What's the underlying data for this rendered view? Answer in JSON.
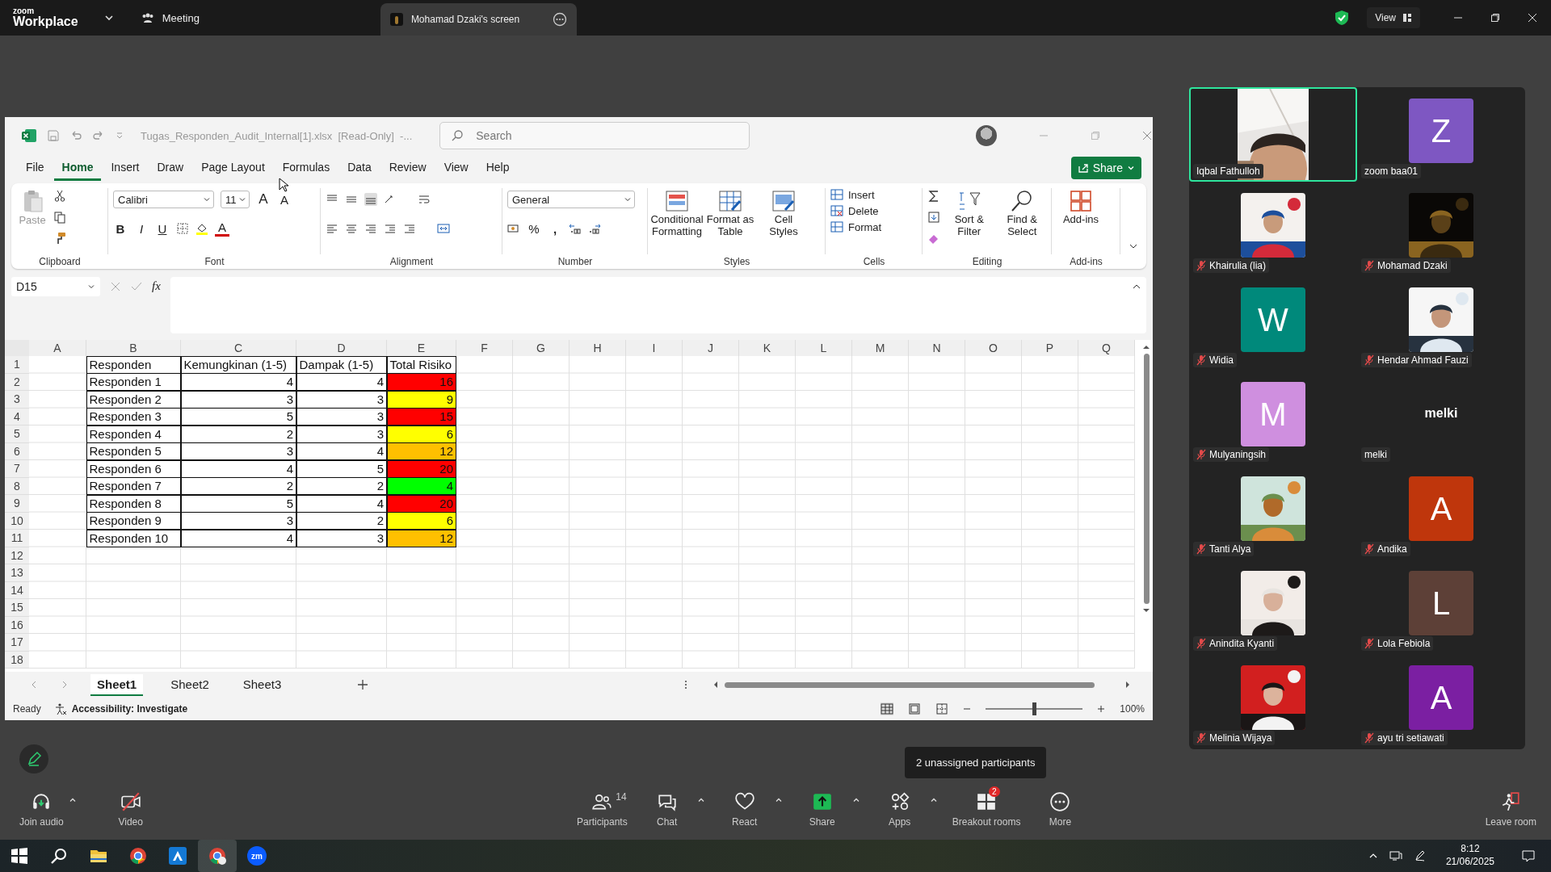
{
  "zoom_bar": {
    "logo_small": "zoom",
    "logo_big": "Workplace",
    "meeting": "Meeting",
    "share_tab": "Mohamad Dzaki's screen",
    "view": "View"
  },
  "excel": {
    "title": "Tugas_Responden_Audit_Internal[1].xlsx  [Read-Only]  -...",
    "search_placeholder": "Search",
    "menu_tabs": [
      {
        "label": "File",
        "selected": false
      },
      {
        "label": "Home",
        "selected": true
      },
      {
        "label": "Insert",
        "selected": false
      },
      {
        "label": "Draw",
        "selected": false
      },
      {
        "label": "Page Layout",
        "selected": false
      },
      {
        "label": "Formulas",
        "selected": false
      },
      {
        "label": "Data",
        "selected": false
      },
      {
        "label": "Review",
        "selected": false
      },
      {
        "label": "View",
        "selected": false
      },
      {
        "label": "Help",
        "selected": false
      }
    ],
    "share_button": "Share",
    "ribbon": {
      "paste": "Paste",
      "font_name": "Calibri",
      "font_size": "11",
      "grow_font": "A",
      "shrink_font": "A",
      "bold": "B",
      "italic": "I",
      "underline": "U",
      "font_color": "A",
      "number_format": "General",
      "percent": "%",
      "comma": ",",
      "styles": [
        "Conditional Formatting",
        "Format as Table",
        "Cell Styles"
      ],
      "cells": [
        "Insert",
        "Delete",
        "Format"
      ],
      "editing": [
        "Sort & Filter",
        "Find & Select"
      ],
      "addins": "Add-ins",
      "group_labels": [
        "Clipboard",
        "Font",
        "Alignment",
        "Number",
        "Styles",
        "Cells",
        "Editing",
        "Add-ins"
      ]
    },
    "formula_bar": {
      "name_box": "D15",
      "fx": "fx"
    },
    "columns": [
      "A",
      "B",
      "C",
      "D",
      "E",
      "F",
      "G",
      "H",
      "I",
      "J",
      "K",
      "L",
      "M",
      "N",
      "O",
      "P",
      "Q"
    ],
    "row_numbers": [
      "1",
      "2",
      "3",
      "4",
      "5",
      "6",
      "7",
      "8",
      "9",
      "10",
      "11",
      "12",
      "13",
      "14",
      "15",
      "16",
      "17",
      "18"
    ],
    "sheet": {
      "header": [
        "Responden",
        "Kemungkinan (1-5)",
        "Dampak (1-5)",
        "Total Risiko"
      ],
      "rows": [
        {
          "name": "Responden 1",
          "likelihood": "4",
          "impact": "4",
          "total": "16",
          "color": "#ff0000"
        },
        {
          "name": "Responden 2",
          "likelihood": "3",
          "impact": "3",
          "total": "9",
          "color": "#ffff00"
        },
        {
          "name": "Responden 3",
          "likelihood": "5",
          "impact": "3",
          "total": "15",
          "color": "#ff0000"
        },
        {
          "name": "Responden 4",
          "likelihood": "2",
          "impact": "3",
          "total": "6",
          "color": "#ffff00"
        },
        {
          "name": "Responden 5",
          "likelihood": "3",
          "impact": "4",
          "total": "12",
          "color": "#ffc000"
        },
        {
          "name": "Responden 6",
          "likelihood": "4",
          "impact": "5",
          "total": "20",
          "color": "#ff0000"
        },
        {
          "name": "Responden 7",
          "likelihood": "2",
          "impact": "2",
          "total": "4",
          "color": "#00ff00"
        },
        {
          "name": "Responden 8",
          "likelihood": "5",
          "impact": "4",
          "total": "20",
          "color": "#ff0000"
        },
        {
          "name": "Responden 9",
          "likelihood": "3",
          "impact": "2",
          "total": "6",
          "color": "#ffff00"
        },
        {
          "name": "Responden 10",
          "likelihood": "4",
          "impact": "3",
          "total": "12",
          "color": "#ffc000"
        }
      ]
    },
    "sheets": [
      {
        "label": "Sheet1",
        "selected": true
      },
      {
        "label": "Sheet2",
        "selected": false
      },
      {
        "label": "Sheet3",
        "selected": false
      }
    ],
    "status": {
      "ready": "Ready",
      "accessibility": "Accessibility: Investigate",
      "zoom": "100%",
      "zoom_slider": {
        "level": 0.5
      }
    }
  },
  "participants": [
    {
      "name": "Iqbal Fathulloh",
      "kind": "video",
      "muted": false,
      "active": true
    },
    {
      "name": "zoom baa01",
      "kind": "letter",
      "letter": "Z",
      "color": "#7e57c2",
      "muted": false,
      "active": false
    },
    {
      "name": "Khairulia (lia)",
      "kind": "picture",
      "muted": true,
      "active": false
    },
    {
      "name": "Mohamad Dzaki",
      "kind": "picture",
      "muted": true,
      "active": false
    },
    {
      "name": "Widia",
      "kind": "letter",
      "letter": "W",
      "color": "#00897b",
      "muted": true,
      "active": false
    },
    {
      "name": "Hendar Ahmad Fauzi",
      "kind": "picture",
      "muted": true,
      "active": false
    },
    {
      "name": "Mulyaningsih",
      "kind": "letter",
      "letter": "M",
      "color": "#cf8fdf",
      "muted": true,
      "active": false
    },
    {
      "name": "melki",
      "kind": "name",
      "display": "melki",
      "muted": false,
      "active": false
    },
    {
      "name": "Tanti Alya",
      "kind": "picture",
      "muted": true,
      "active": false
    },
    {
      "name": "Andika",
      "kind": "letter",
      "letter": "A",
      "color": "#bf360c",
      "muted": true,
      "active": false
    },
    {
      "name": "Anindita Kyanti",
      "kind": "picture",
      "muted": true,
      "active": false
    },
    {
      "name": "Lola Febiola",
      "kind": "letter",
      "letter": "L",
      "color": "#5d4037",
      "muted": true,
      "active": false
    },
    {
      "name": "Melinia Wijaya",
      "kind": "picture",
      "muted": true,
      "active": false
    },
    {
      "name": "ayu tri setiawati",
      "kind": "letter",
      "letter": "A",
      "color": "#7b1fa2",
      "muted": true,
      "active": false
    }
  ],
  "toolbar": {
    "tooltip": "2 unassigned participants",
    "left": [
      {
        "kind": "audio",
        "label": "Join audio",
        "has_menu": true,
        "off": false
      },
      {
        "kind": "video",
        "label": "Video",
        "has_menu": false,
        "off": true
      }
    ],
    "center": [
      {
        "kind": "participants",
        "label": "Participants",
        "count": "14",
        "has_menu": false,
        "off": false
      },
      {
        "kind": "chat",
        "label": "Chat",
        "has_menu": true,
        "off": false
      },
      {
        "kind": "react",
        "label": "React",
        "has_menu": true,
        "off": false
      },
      {
        "kind": "share",
        "label": "Share",
        "has_menu": true,
        "off": false
      },
      {
        "kind": "apps",
        "label": "Apps",
        "has_menu": true,
        "off": false
      },
      {
        "kind": "breakout",
        "label": "Breakout rooms",
        "badge": "2",
        "has_menu": false,
        "off": false
      },
      {
        "kind": "more",
        "label": "More",
        "has_menu": false,
        "off": false
      }
    ],
    "leave": "Leave room"
  },
  "taskbar": {
    "zoom_app": "zm",
    "time": "8:12",
    "date": "21/06/2025"
  }
}
